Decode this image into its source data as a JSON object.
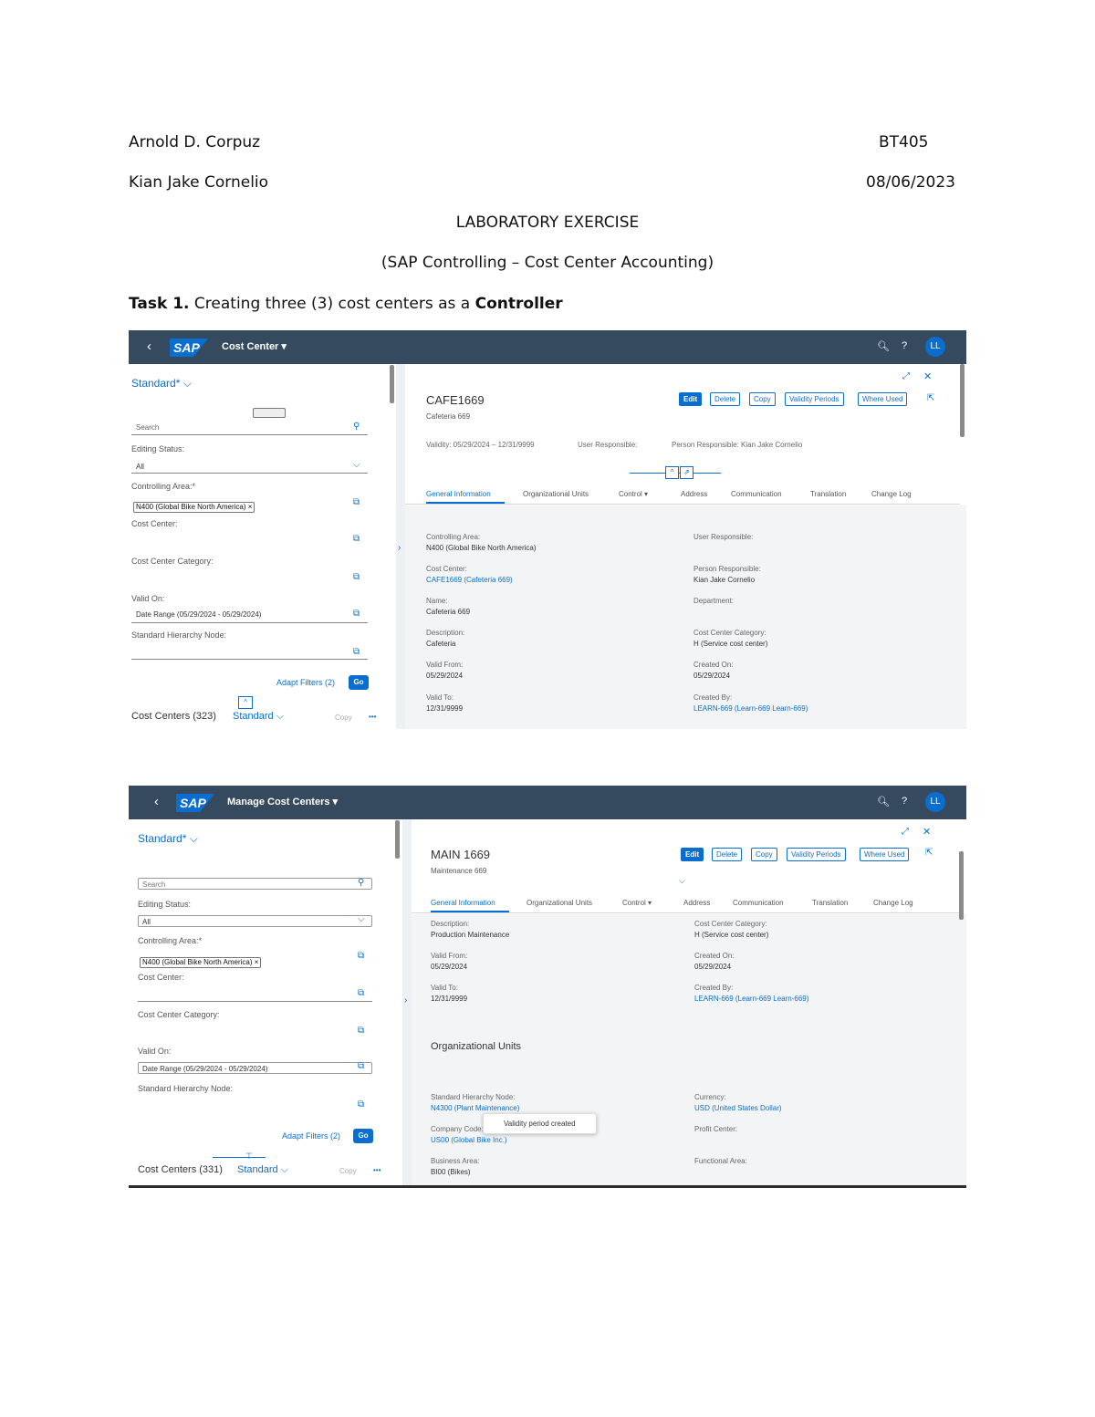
{
  "header": {
    "name1": "Arnold   D. Corpuz",
    "code": "BT405",
    "name2": "Kian Jake Cornelio",
    "date": "08/06/2023",
    "title": "LABORATORY EXERCISE",
    "subtitle": "(SAP Controlling – Cost Center Accounting)",
    "task_bold": "Task 1.",
    "task_text": " Creating three (3) cost centers as a ",
    "task_role": "Controller"
  },
  "shot1": {
    "app_title": "Cost Center ▾",
    "avatar": "LL",
    "variant": "Standard* ",
    "search_placeholder": "Search",
    "editing_status_label": "Editing Status:",
    "editing_status_value": "All",
    "controlling_area_label": "Controlling Area:*",
    "controlling_area_token": "N400 (Global Bike North America) ×",
    "cost_center_label": "Cost Center:",
    "cost_center_category_label": "Cost Center Category:",
    "valid_on_label": "Valid On:",
    "valid_on_value": "Date Range (05/29/2024 - 05/29/2024)",
    "hierarchy_label": "Standard Hierarchy Node:",
    "adapt_filters": "Adapt Filters (2)",
    "go": "Go",
    "list_count": "Cost Centers (323)",
    "list_variant": "Standard",
    "list_copy": "Copy",
    "object_title": "CAFE1669",
    "object_subtitle": "Cafeteria 669",
    "buttons": [
      "Edit",
      "Delete",
      "Copy",
      "Validity Periods",
      "Where Used"
    ],
    "validity": "Validity: 05/29/2024 – 12/31/9999",
    "user_responsible": "User Responsible:",
    "person_responsible": "Person Responsible: Kian Jake Cornelio",
    "tabs": [
      "General Information",
      "Organizational Units",
      "Control ▾",
      "Address",
      "Communication",
      "Translation",
      "Change Log"
    ],
    "fields_left": [
      {
        "label": "Controlling Area:",
        "value": "N400 (Global Bike North America)"
      },
      {
        "label": "Cost Center:",
        "value": "CAFE1669 (Cafeteria 669)"
      },
      {
        "label": "Name:",
        "value": "Cafeteria 669"
      },
      {
        "label": "Description:",
        "value": "Cafeteria"
      },
      {
        "label": "Valid From:",
        "value": "05/29/2024"
      },
      {
        "label": "Valid To:",
        "value": "12/31/9999"
      }
    ],
    "fields_right": [
      {
        "label": "User Responsible:",
        "value": ""
      },
      {
        "label": "Person Responsible:",
        "value": "Kian Jake Cornelio"
      },
      {
        "label": "Department:",
        "value": ""
      },
      {
        "label": "Cost Center Category:",
        "value": "H (Service cost center)"
      },
      {
        "label": "Created On:",
        "value": "05/29/2024"
      },
      {
        "label": "Created By:",
        "value": "LEARN-669 (Learn-669 Learn-669)"
      }
    ]
  },
  "shot2": {
    "app_title": "Manage Cost Centers ▾",
    "avatar": "LL",
    "variant": "Standard* ",
    "search_placeholder": "Search",
    "editing_status_label": "Editing Status:",
    "editing_status_value": "All",
    "controlling_area_label": "Controlling Area:*",
    "controlling_area_token": "N400 (Global Bike North America) ×",
    "cost_center_label": "Cost Center:",
    "cost_center_category_label": "Cost Center Category:",
    "valid_on_label": "Valid On:",
    "valid_on_value": "Date Range (05/29/2024 - 05/29/2024)",
    "hierarchy_label": "Standard Hierarchy Node:",
    "adapt_filters": "Adapt Filters (2)",
    "go": "Go",
    "list_count": "Cost Centers (331)",
    "list_variant": "Standard",
    "list_copy": "Copy",
    "object_title": "MAIN 1669",
    "object_subtitle": "Maintenance 669",
    "buttons": [
      "Edit",
      "Delete",
      "Copy",
      "Validity Periods",
      "Where Used"
    ],
    "tabs": [
      "General Information",
      "Organizational Units",
      "Control ▾",
      "Address",
      "Communication",
      "Translation",
      "Change Log"
    ],
    "fields_left": [
      {
        "label": "Description:",
        "value": "Production Maintenance"
      },
      {
        "label": "Valid From:",
        "value": "05/29/2024"
      },
      {
        "label": "Valid To:",
        "value": "12/31/9999"
      }
    ],
    "fields_right": [
      {
        "label": "Cost Center Category:",
        "value": "H (Service cost center)"
      },
      {
        "label": "Created On:",
        "value": "05/29/2024"
      },
      {
        "label": "Created By:",
        "value": "LEARN-669 (Learn-669 Learn-669)"
      }
    ],
    "org_section": "Organizational Units",
    "org_left": [
      {
        "label": "Standard Hierarchy Node:",
        "value": "N4300 (Plant Maintenance)"
      },
      {
        "label": "Company Code:",
        "value": "US00 (Global Bike Inc.)"
      },
      {
        "label": "Business Area:",
        "value": "BI00 (Bikes)"
      }
    ],
    "org_right": [
      {
        "label": "Currency:",
        "value": "USD (United States Dollar)"
      },
      {
        "label": "Profit Center:",
        "value": ""
      },
      {
        "label": "Functional Area:",
        "value": ""
      }
    ],
    "toast": "Validity period created"
  }
}
